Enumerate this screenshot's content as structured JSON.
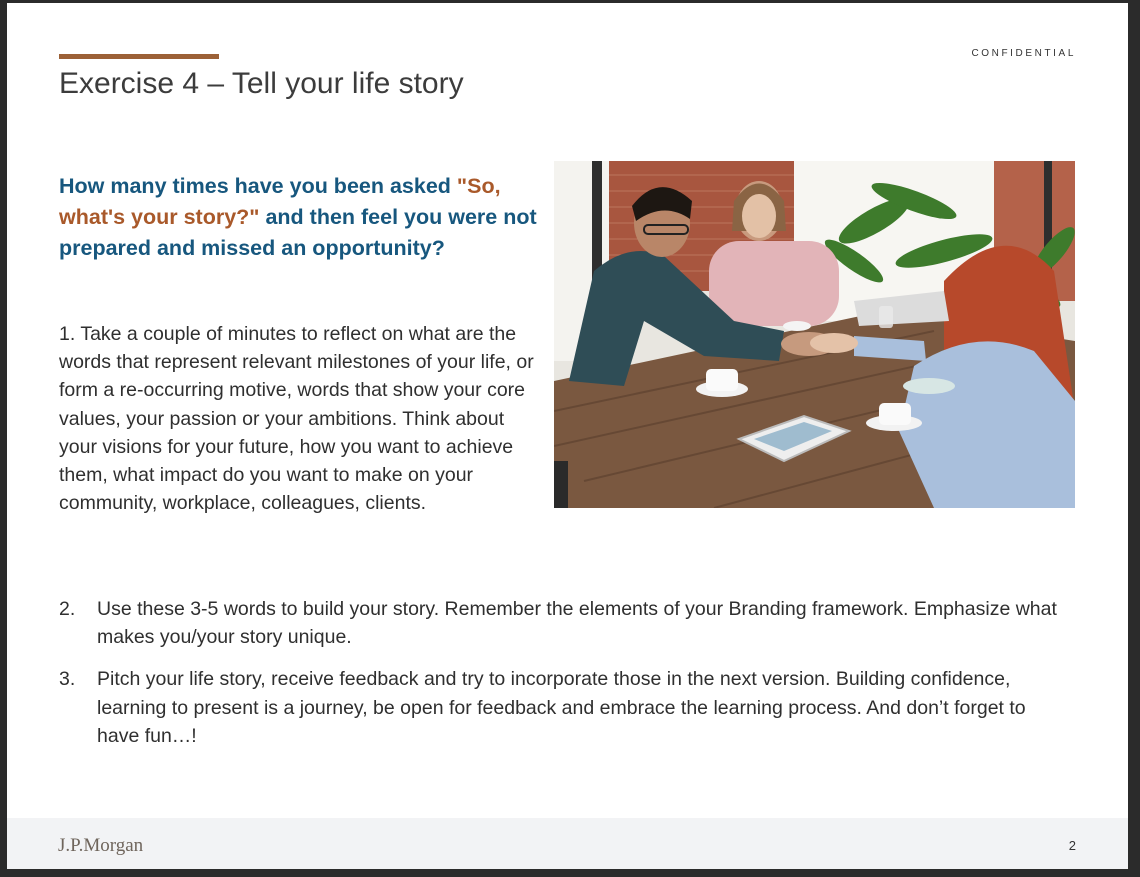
{
  "header": {
    "confidential": "CONFIDENTIAL",
    "title": "Exercise 4 – Tell your life story"
  },
  "question": {
    "part1": "How many times have you been asked ",
    "highlight": "\"So, what's your story?\"",
    "part2": " and then feel you were not prepared and missed an opportunity?"
  },
  "step1": "1. Take a couple of minutes to reflect on what are the words that represent relevant milestones of your life, or form a re-occurring motive, words that show your core values, your passion or your ambitions. Think about your visions for your future, how you want to achieve them, what impact do you want to make on your community, workplace, colleagues, clients.",
  "steps": [
    {
      "num": "2.",
      "text": "Use these 3-5 words to build your story. Remember the elements of your Branding framework. Emphasize what makes you/your story unique."
    },
    {
      "num": "3.",
      "text": "Pitch your life story, receive feedback and try to incorporate those in the next version. Building confidence, learning to present is a journey, be open for feedback and embrace the learning process. And don’t forget to have fun…!"
    }
  ],
  "footer": {
    "logo": "J.P.Morgan",
    "page": "2"
  },
  "colors": {
    "accent": "#9c6137",
    "question_blue": "#17577e",
    "question_highlight": "#a9592a",
    "footer_bg": "#f2f3f5"
  }
}
